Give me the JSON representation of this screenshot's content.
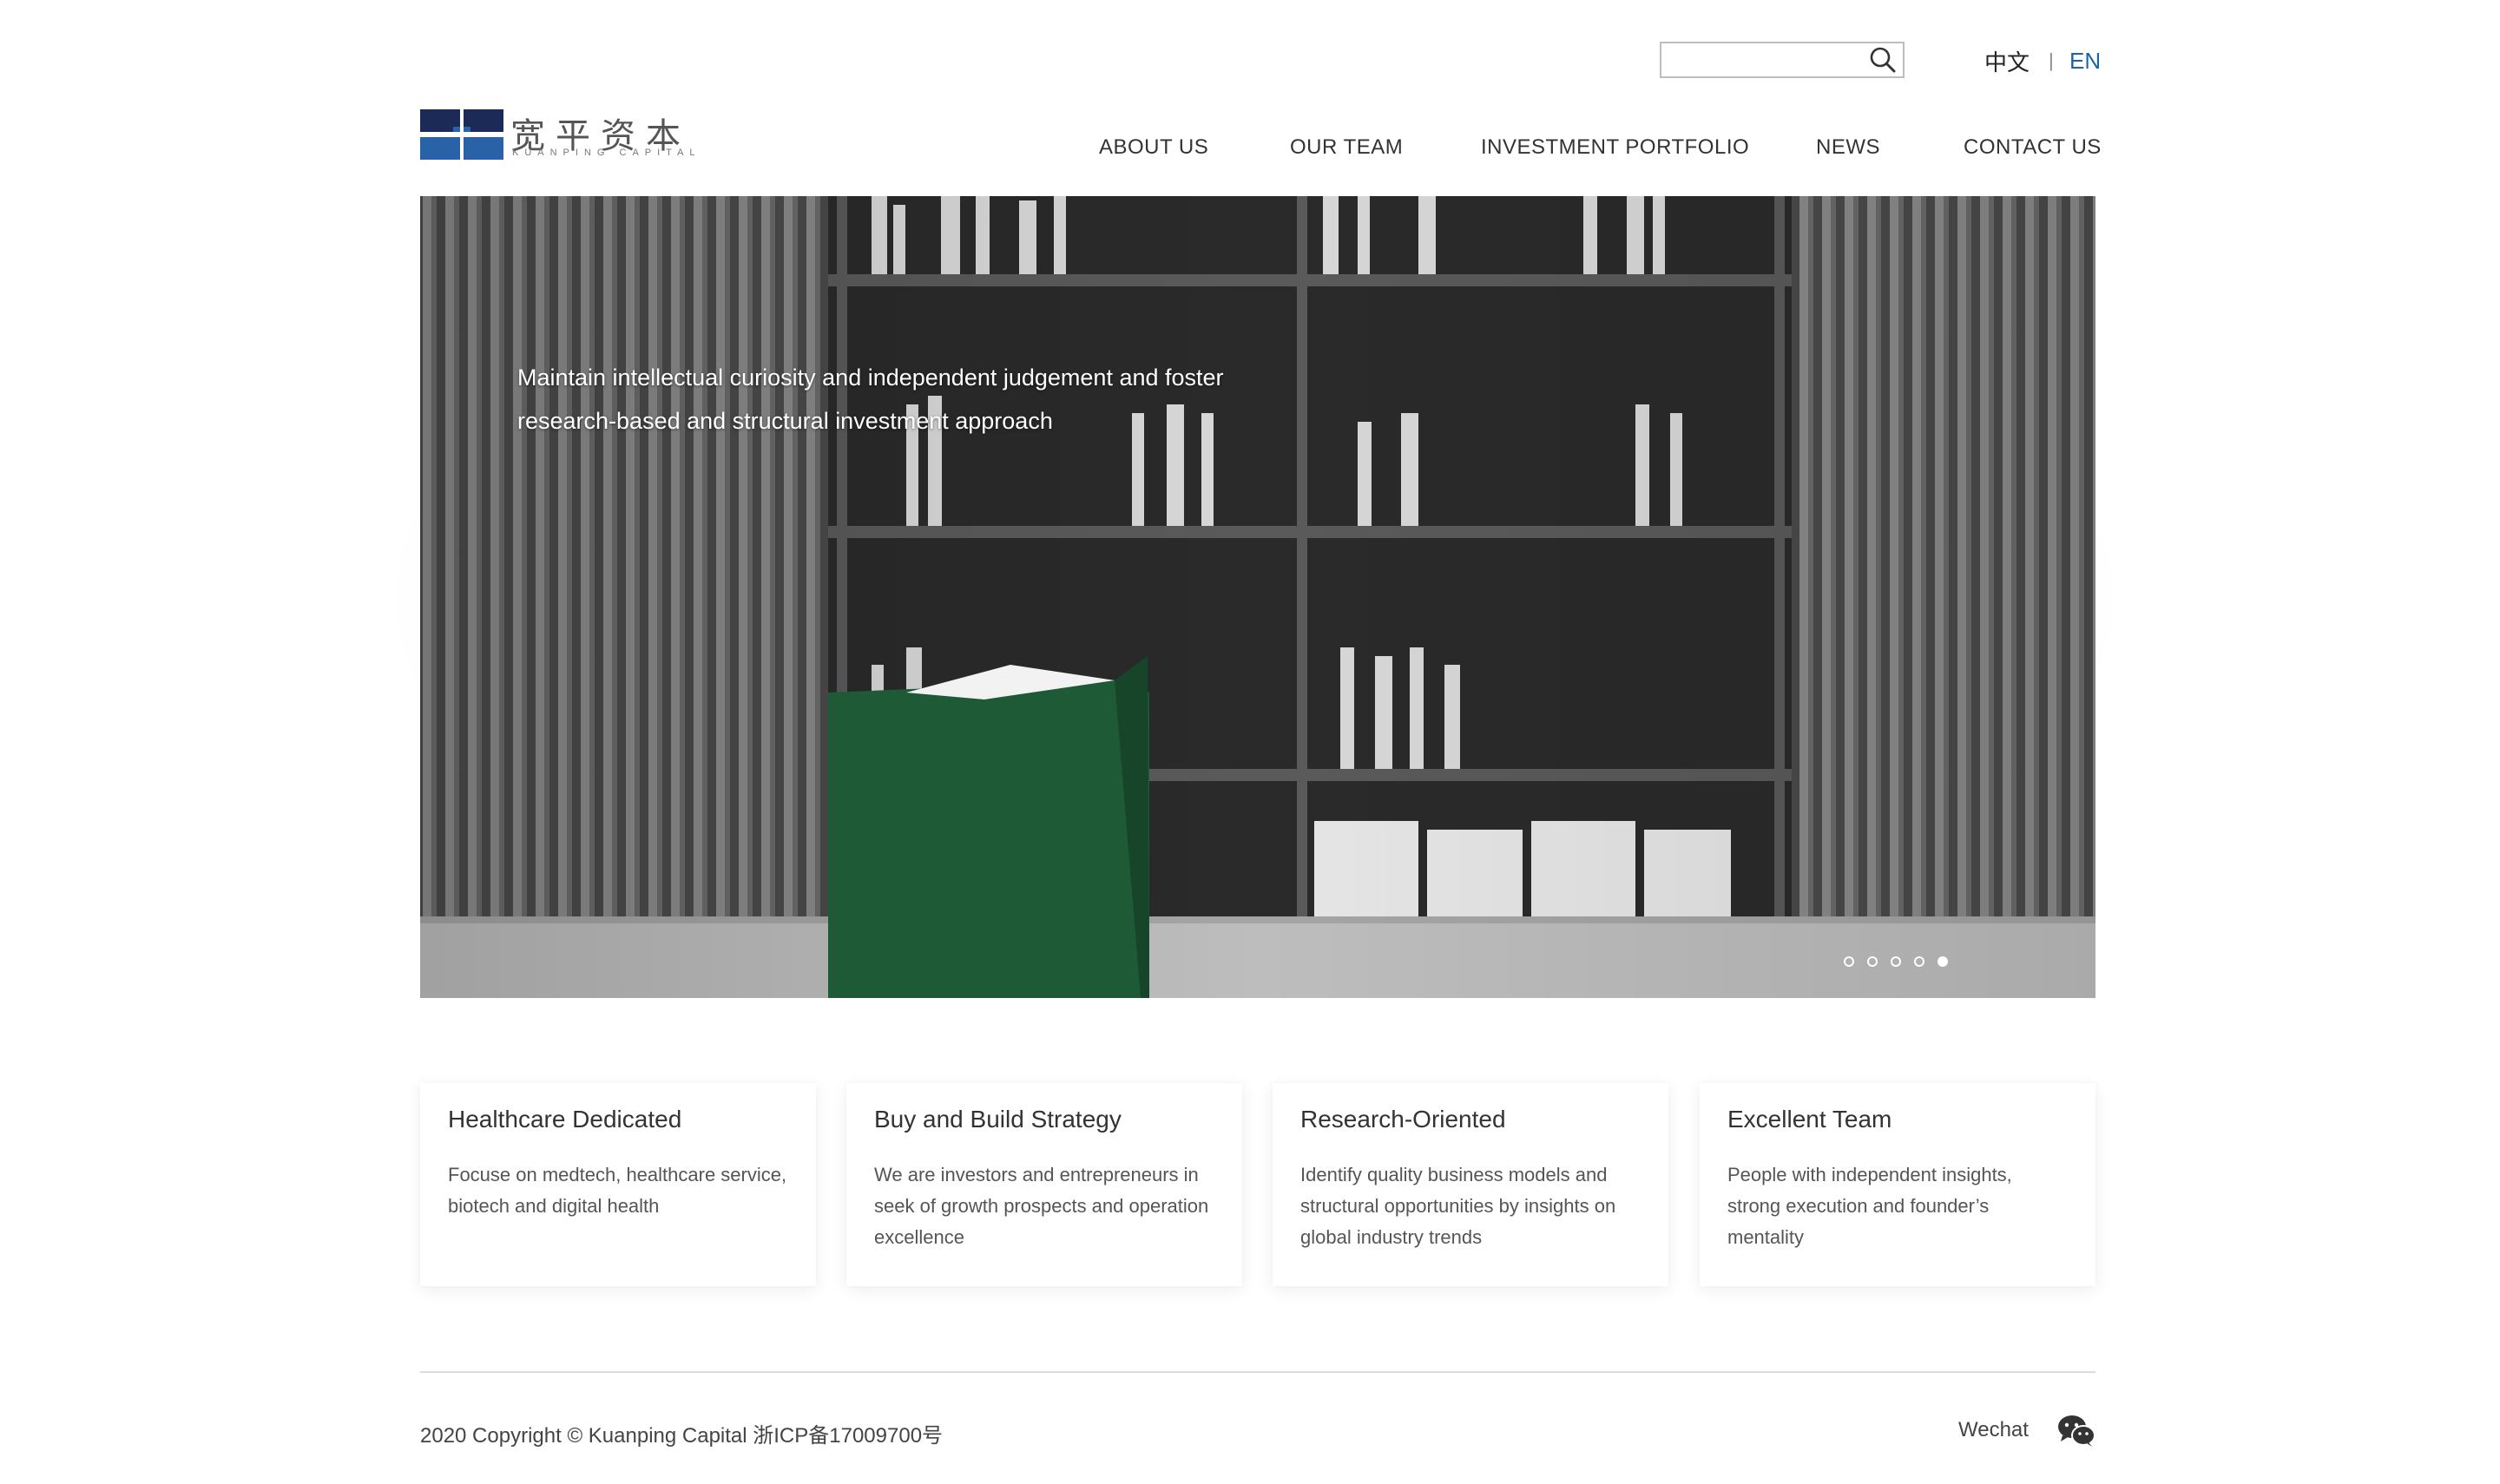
{
  "header": {
    "search": {
      "value": "",
      "placeholder": ""
    },
    "lang": {
      "zh": "中文",
      "separator": "|",
      "en": "EN"
    },
    "logo": {
      "text": "宽平资本",
      "subtext": "KUANPING CAPITAL"
    },
    "nav": [
      {
        "label": "ABOUT US"
      },
      {
        "label": "OUR TEAM"
      },
      {
        "label": "INVESTMENT PORTFOLIO"
      },
      {
        "label": "NEWS"
      },
      {
        "label": "CONTACT US"
      }
    ]
  },
  "hero": {
    "caption_line1": "Maintain intellectual curiosity and independent judgement and foster",
    "caption_line2": "research-based and structural investment approach",
    "slides_count": 5,
    "active_slide": 5
  },
  "features": [
    {
      "title": "Healthcare Dedicated",
      "description": "Focuse on medtech, healthcare service, biotech and digital health"
    },
    {
      "title": "Buy and Build Strategy",
      "description": "We are investors and entrepreneurs in seek of growth prospects and operation excellence"
    },
    {
      "title": "Research-Oriented",
      "description": "Identify quality business models and structural opportunities by insights on global industry trends"
    },
    {
      "title": "Excellent Team",
      "description": "People with independent insights, strong execution and founder’s mentality"
    }
  ],
  "footer": {
    "copyright": "2020 Copyright © Kuanping Capital 浙ICP备17009700号",
    "wechat_label": "Wechat",
    "wechat_icon": "wechat-icon"
  },
  "colors": {
    "accent": "#1c64a8",
    "logo_navy": "#1b2a56",
    "logo_blue": "#2a62a8",
    "book_green": "#1f5a36"
  }
}
